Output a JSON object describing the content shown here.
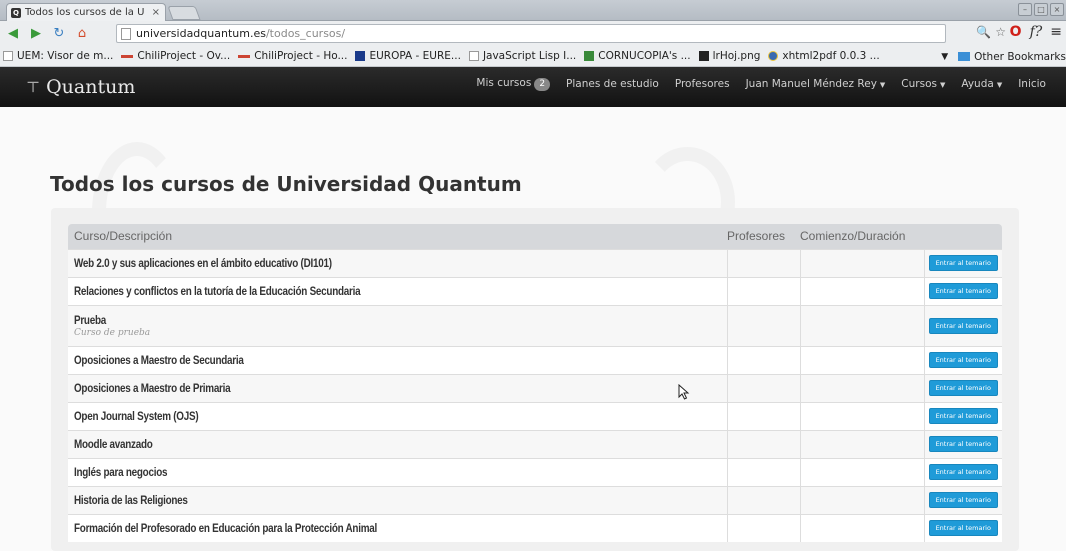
{
  "browser": {
    "tab_title": "Todos los cursos de la U",
    "tab_favicon": "Q",
    "url_host": "universidadquantum.es",
    "url_path": "/todos_cursos/",
    "bookmarks": [
      {
        "label": "UEM: Visor de m...",
        "icon": "page"
      },
      {
        "label": "ChiliProject - Ov...",
        "icon": "red"
      },
      {
        "label": "ChiliProject - Ho...",
        "icon": "red"
      },
      {
        "label": "EUROPA - EURE...",
        "icon": "eu"
      },
      {
        "label": "JavaScript Lisp I...",
        "icon": "page"
      },
      {
        "label": "CORNUCOPIA's ...",
        "icon": "green"
      },
      {
        "label": "lrHoj.png",
        "icon": "black"
      },
      {
        "label": "xhtml2pdf 0.0.3 ...",
        "icon": "py"
      }
    ],
    "other_bookmarks": "Other Bookmarks"
  },
  "site": {
    "brand": "Quantum",
    "nav": {
      "mis_cursos": "Mis cursos",
      "mis_cursos_count": "2",
      "planes": "Planes de estudio",
      "profesores": "Profesores",
      "user": "Juan Manuel Méndez Rey",
      "cursos": "Cursos",
      "ayuda": "Ayuda",
      "inicio": "Inicio"
    }
  },
  "page": {
    "title": "Todos los cursos de Universidad Quantum",
    "table": {
      "headers": [
        "Curso/Descripción",
        "Profesores",
        "Comienzo/Duración",
        ""
      ],
      "button_label": "Entrar al temario",
      "rows": [
        {
          "name": "Web 2.0 y sus aplicaciones en el ámbito educativo (DI101)",
          "desc": ""
        },
        {
          "name": "Relaciones y conflictos en la tutoría de la Educación Secundaria",
          "desc": ""
        },
        {
          "name": "Prueba",
          "desc": "Curso de prueba"
        },
        {
          "name": "Oposiciones a Maestro de Secundaria",
          "desc": ""
        },
        {
          "name": "Oposiciones a Maestro de Primaria",
          "desc": ""
        },
        {
          "name": "Open Journal System (OJS)",
          "desc": ""
        },
        {
          "name": "Moodle avanzado",
          "desc": ""
        },
        {
          "name": "Inglés para negocios",
          "desc": ""
        },
        {
          "name": "Historia de las Religiones",
          "desc": ""
        },
        {
          "name": "Formación del Profesorado en Educación para la Protección Animal",
          "desc": ""
        }
      ]
    }
  },
  "colors": {
    "navbar": "#1b1b1b",
    "button": "#1f9bd8",
    "header_bg": "#d6d8db"
  }
}
